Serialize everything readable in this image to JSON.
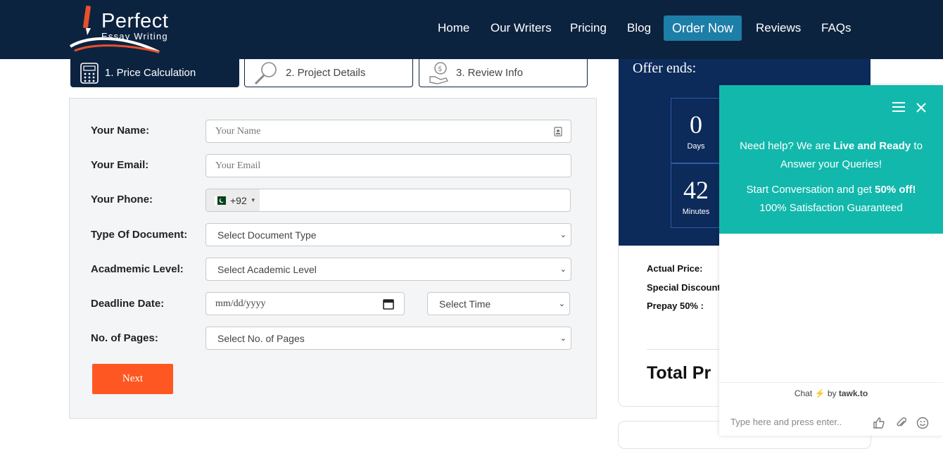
{
  "header": {
    "logo_title": "Perfect",
    "logo_subtitle": "Essay Writing",
    "nav": {
      "home": "Home",
      "writers": "Our Writers",
      "pricing": "Pricing",
      "blog": "Blog",
      "order": "Order Now",
      "reviews": "Reviews",
      "faqs": "FAQs"
    }
  },
  "steps": {
    "step1": "1. Price Calculation",
    "step2": "2. Project Details",
    "step3": "3. Review Info"
  },
  "form": {
    "name_label": "Your Name:",
    "name_placeholder": "Your Name",
    "email_label": "Your Email:",
    "email_placeholder": "Your Email",
    "phone_label": "Your Phone:",
    "phone_code": "+92",
    "doc_label": "Type Of Document:",
    "doc_value": "Select Document Type",
    "level_label": "Acadmemic Level:",
    "level_value": "Select Academic Level",
    "deadline_label": "Deadline Date:",
    "date_placeholder": "mm/dd/yyyy",
    "time_value": "Select Time",
    "pages_label": "No. of Pages:",
    "pages_value": "Select No. of Pages",
    "next_label": "Next"
  },
  "offer": {
    "title": "Offer ends:",
    "days_value": "0",
    "days_label": "Days",
    "minutes_value": "42",
    "minutes_label": "Minutes"
  },
  "pricing": {
    "actual": "Actual Price:",
    "discount": "Special Discount",
    "prepay": "Prepay 50% :",
    "total": "Total Pr"
  },
  "chat": {
    "line1_a": "Need help? We are ",
    "line1_b": "Live and Ready",
    "line1_c": " to",
    "line2": "Answer your Queries!",
    "line3_a": "Start Conversation and get ",
    "line3_b": "50% off!",
    "line4": "100% Satisfaction Guaranteed",
    "brand_a": "Chat",
    "brand_b": "by",
    "brand_c": "tawk.to",
    "input_placeholder": "Type here and press enter.."
  },
  "colors": {
    "navy": "#0c2340",
    "cta": "#1d7ea8",
    "orange": "#ff5722",
    "teal": "#12b8ac"
  }
}
